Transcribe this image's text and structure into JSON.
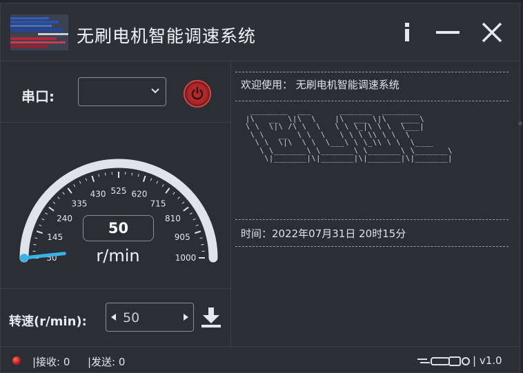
{
  "window": {
    "title": "无刷电机智能调速系统"
  },
  "titlebar": {
    "info_icon": "info-icon",
    "minimize_icon": "minimize-icon",
    "close_icon": "close-icon"
  },
  "port": {
    "label": "串口:",
    "selected": "",
    "power_icon": "power-icon",
    "power_color": "#b0282a"
  },
  "gauge": {
    "ticks": [
      "50",
      "145",
      "240",
      "335",
      "430",
      "525",
      "620",
      "715",
      "810",
      "905",
      "1000"
    ],
    "min": 50,
    "max": 1000,
    "current_value": "50",
    "unit": "r/min",
    "accent_color": "#37b3e6"
  },
  "speed": {
    "label": "转速(r/min):",
    "value": "50",
    "download_icon": "download-icon"
  },
  "log": {
    "welcome": "欢迎使用： 无刷电机智能调速系统",
    "ascii_art": "  ________  ___      _______  ________\n |\\   __  \\|\\  \\    |\\  ___ \\|\\   ____\\\n \\ \\  \\|\\ /\\ \\  \\   \\ \\ \\_|\\ \\ \\  \\___|\n  \\ \\   __  \\ \\  \\   \\ \\ \\ \\\\ \\ \\  \\\n   \\ \\  \\|\\  \\ \\  \\___\\ \\ \\_\\\\ \\ \\  \\____\n    \\ \\_______\\ \\_______\\ \\_______\\ \\_______\\\n     \\|_______|\\|_______|\\|_______|\\|_______|",
    "time": "时间：2022年07月31日 20时15分"
  },
  "status": {
    "recv": "|接收: 0",
    "send": "|发送: 0",
    "version": "| v1.0",
    "led_color": "#d11c1c",
    "connection_icon": "usb-cable-icon"
  }
}
